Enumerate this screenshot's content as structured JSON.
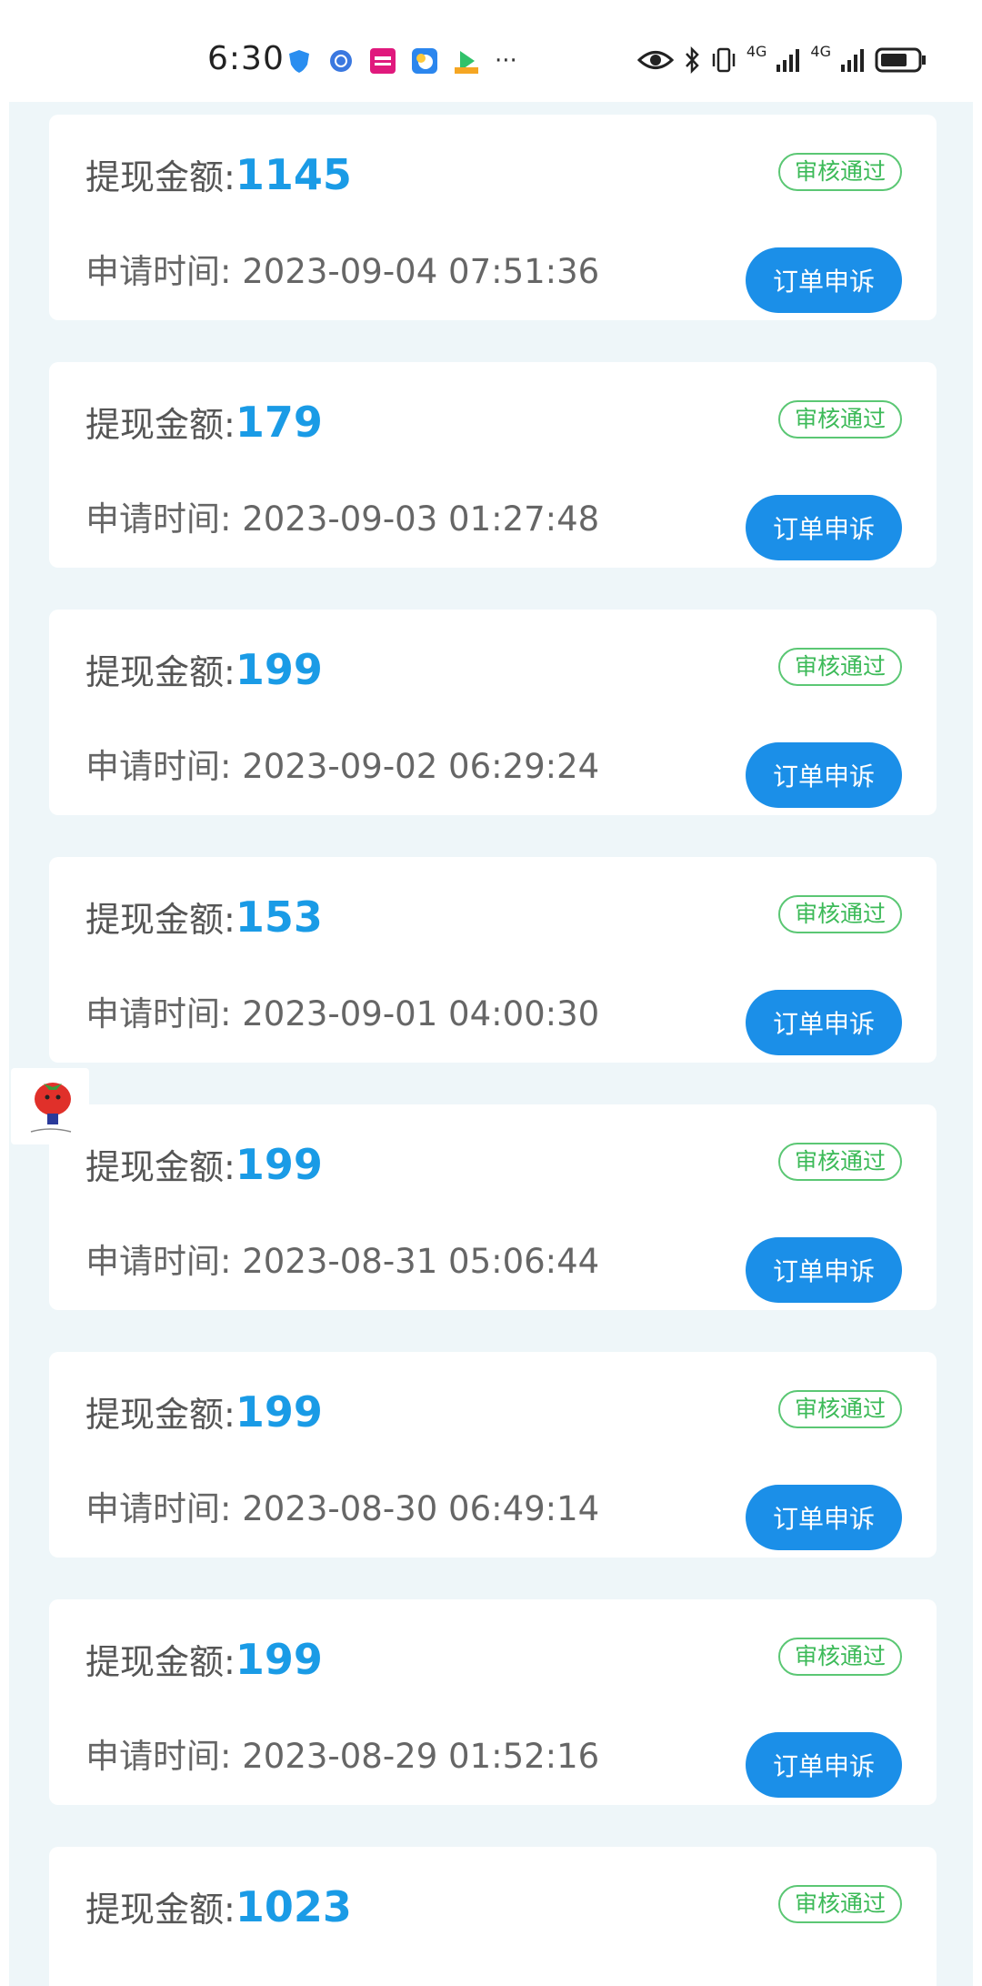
{
  "status_bar": {
    "time": "6:30",
    "more": "···",
    "net1": "4G",
    "net2": "4G"
  },
  "labels": {
    "amount_label": "提现金额:",
    "time_label": "申请时间: ",
    "status": "审核通过",
    "appeal_button": "订单申诉"
  },
  "records": [
    {
      "amount": "1145",
      "time": "2023-09-04 07:51:36"
    },
    {
      "amount": "179",
      "time": "2023-09-03 01:27:48"
    },
    {
      "amount": "199",
      "time": "2023-09-02 06:29:24"
    },
    {
      "amount": "153",
      "time": "2023-09-01 04:00:30"
    },
    {
      "amount": "199",
      "time": "2023-08-31 05:06:44"
    },
    {
      "amount": "199",
      "time": "2023-08-30 06:49:14"
    },
    {
      "amount": "199",
      "time": "2023-08-29 01:52:16"
    },
    {
      "amount": "1023",
      "time": ""
    }
  ],
  "colors": {
    "accent": "#1a9be6",
    "button": "#1b8fe8",
    "badge": "#3cba58",
    "background": "#eef6f9"
  }
}
